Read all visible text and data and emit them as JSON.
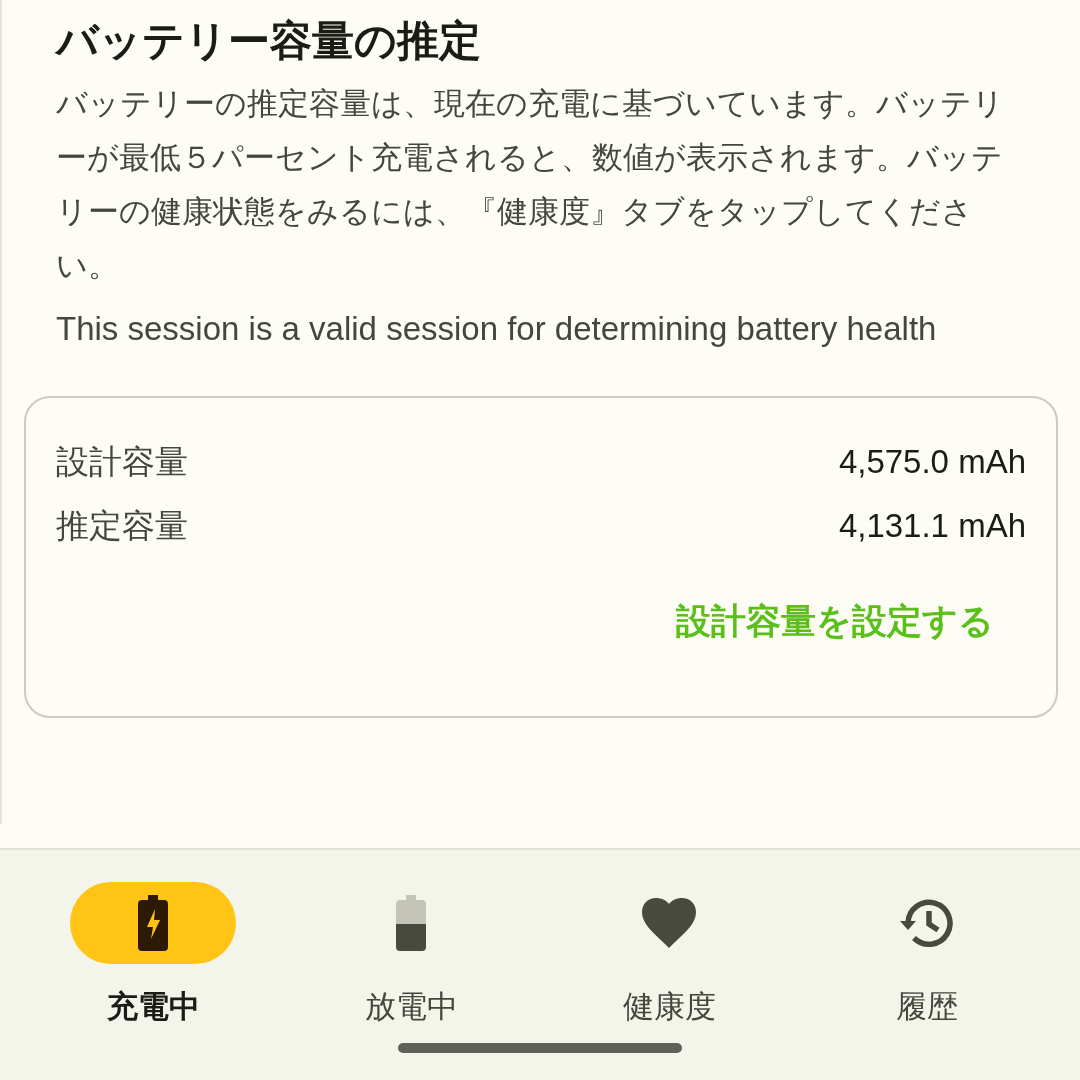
{
  "title": "バッテリー容量の推定",
  "description": "バッテリーの推定容量は、現在の充電に基づいています。バッテリーが最低５パーセント充電されると、数値が表示されます。バッテリーの健康状態をみるには、『健康度』タブをタップしてください。",
  "session_note": "This session is a valid session for determining battery health",
  "capacity_card": {
    "rows": [
      {
        "label": "設計容量",
        "value": "4,575.0 mAh"
      },
      {
        "label": "推定容量",
        "value": "4,131.1 mAh"
      }
    ],
    "action": "設計容量を設定する"
  },
  "nav_tabs": [
    {
      "label": "充電中",
      "kind": "charging",
      "selected": true
    },
    {
      "label": "放電中",
      "kind": "discharging",
      "selected": false
    },
    {
      "label": "健康度",
      "kind": "health",
      "selected": false
    },
    {
      "label": "履歴",
      "kind": "history",
      "selected": false
    }
  ]
}
